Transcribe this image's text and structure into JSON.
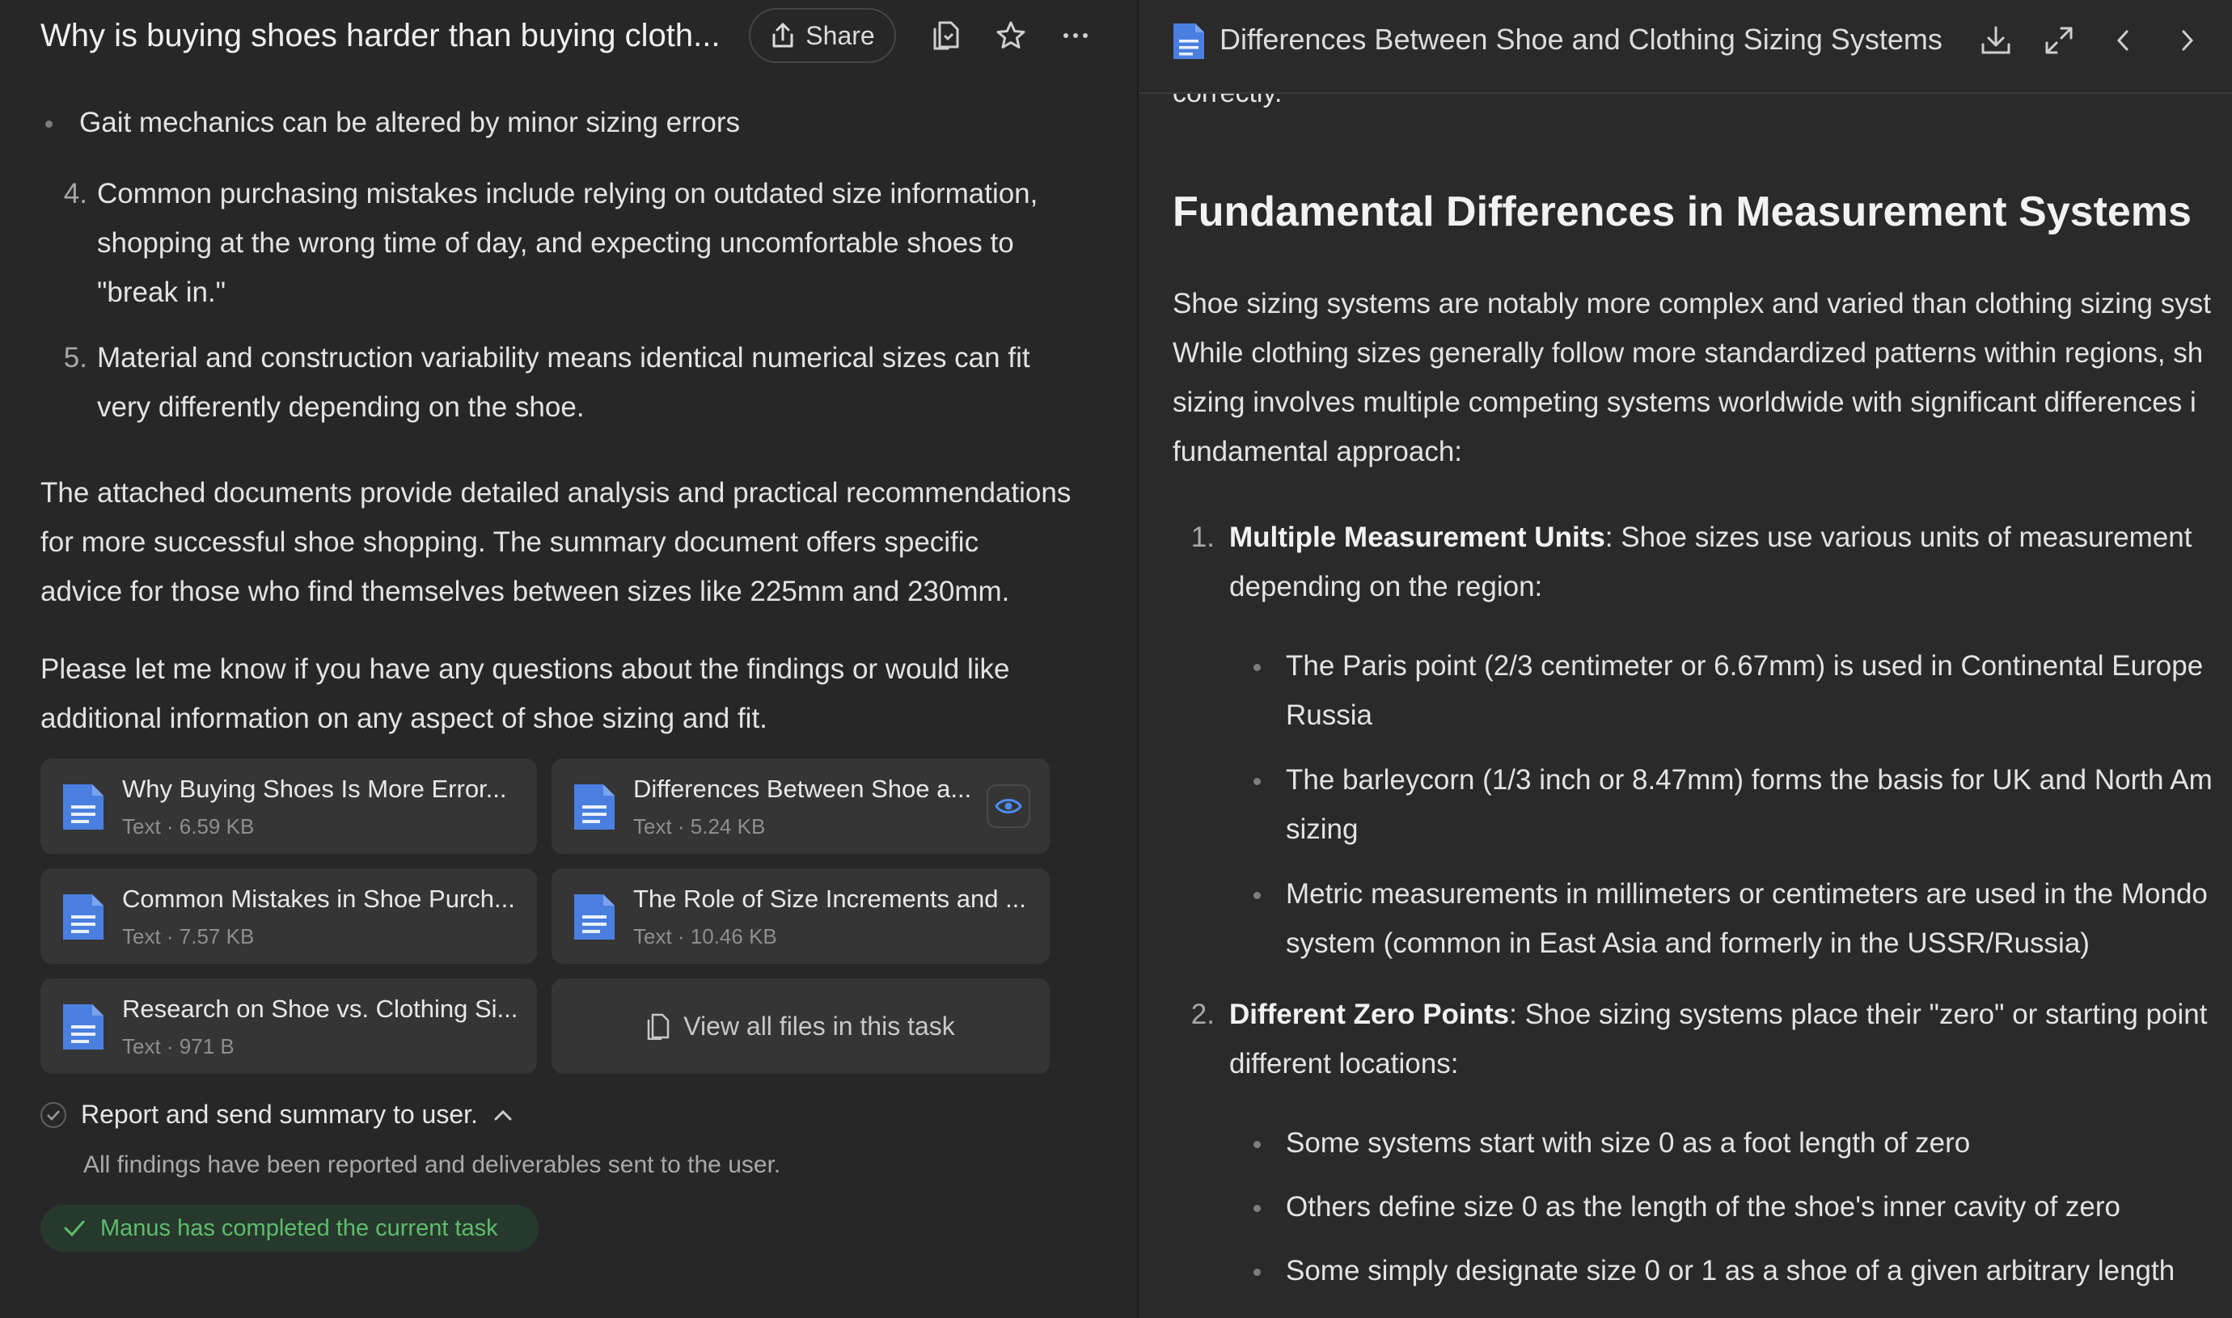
{
  "left": {
    "title": "Why is buying shoes harder than buying cloth...",
    "share_label": "Share",
    "icons": [
      "files-icon",
      "star-icon",
      "more-icon"
    ],
    "bullet_text": "Gait mechanics can be altered by minor sizing errors",
    "items": [
      {
        "num": "4.",
        "lines": [
          "Common purchasing mistakes include relying on outdated size information,",
          "shopping at the wrong time of day, and expecting uncomfortable shoes to",
          "\"break in.\""
        ]
      },
      {
        "num": "5.",
        "lines": [
          "Material and construction variability means identical numerical sizes can fit",
          "very differently depending on the shoe."
        ]
      }
    ],
    "para1": [
      "The attached documents provide detailed analysis and practical recommendations",
      "for more successful shoe shopping. The summary document offers specific",
      "advice for those who find themselves between sizes like 225mm and 230mm."
    ],
    "para2": [
      "Please let me know if you have any questions about the findings or would like",
      "additional information on any aspect of shoe sizing and fit."
    ],
    "files": [
      {
        "name": "Why Buying Shoes Is More Error...",
        "meta": "Text · 6.59 KB"
      },
      {
        "name": "Differences Between Shoe a...",
        "meta": "Text · 5.24 KB"
      },
      {
        "name": "Common Mistakes in Shoe Purch...",
        "meta": "Text · 7.57 KB"
      },
      {
        "name": "The Role of Size Increments and ...",
        "meta": "Text · 10.46 KB"
      },
      {
        "name": "Research on Shoe vs. Clothing Si...",
        "meta": "Text · 971 B"
      }
    ],
    "view_all": "View all files in this task",
    "step_title": "Report and send summary to user.",
    "step_desc": "All findings have been reported and deliverables sent to the user.",
    "done_text": "Manus has completed the current task",
    "accent_green": "#5dbd6c",
    "accent_blue": "#4a8cf0"
  },
  "right": {
    "title": "Differences Between Shoe and Clothing Sizing Systems",
    "cut_text": "correctly.",
    "heading": "Fundamental Differences in Measurement Systems",
    "intro": [
      "Shoe sizing systems are notably more complex and varied than clothing sizing syst",
      "While clothing sizes generally follow more standardized patterns within regions, sh",
      "sizing involves multiple competing systems worldwide with significant differences i",
      "fundamental approach:"
    ],
    "list": [
      {
        "num": "1.",
        "bold": "Multiple Measurement Units",
        "rest": ": Shoe sizes use various units of measurement",
        "line2": "depending on the region:",
        "bullets": [
          [
            "The Paris point (2/3 centimeter or 6.67mm) is used in Continental Europe",
            "Russia"
          ],
          [
            "The barleycorn (1/3 inch or 8.47mm) forms the basis for UK and North Am",
            "sizing"
          ],
          [
            "Metric measurements in millimeters or centimeters are used in the Mondo",
            "system (common in East Asia and formerly in the USSR/Russia)"
          ]
        ]
      },
      {
        "num": "2.",
        "bold": "Different Zero Points",
        "rest": ": Shoe sizing systems place their \"zero\" or starting point",
        "line2": "different locations:",
        "bullets": [
          [
            "Some systems start with size 0 as a foot length of zero"
          ],
          [
            "Others define size 0 as the length of the shoe's inner cavity of zero"
          ],
          [
            "Some simply designate size 0 or 1 as a shoe of a given arbitrary length"
          ]
        ]
      }
    ]
  }
}
